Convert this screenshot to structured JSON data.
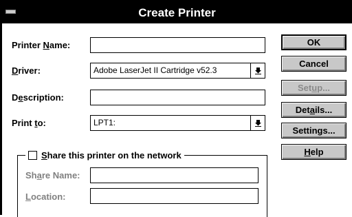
{
  "window": {
    "title": "Create Printer"
  },
  "fields": {
    "printer_name": {
      "label_pre": "Printer ",
      "label_ul": "N",
      "label_post": "ame:",
      "value": ""
    },
    "driver": {
      "label_pre": "",
      "label_ul": "D",
      "label_post": "river:",
      "value": "Adobe LaserJet II Cartridge v52.3"
    },
    "description": {
      "label_pre": "D",
      "label_ul": "e",
      "label_post": "scription:",
      "value": ""
    },
    "print_to": {
      "label_pre": "Print ",
      "label_ul": "t",
      "label_post": "o:",
      "value": "LPT1:"
    }
  },
  "share": {
    "checkbox_pre": "",
    "checkbox_ul": "S",
    "checkbox_post": "hare this printer on the network",
    "checked": false,
    "share_name": {
      "label_pre": "Sh",
      "label_ul": "a",
      "label_post": "re Name:",
      "value": ""
    },
    "location": {
      "label_pre": "",
      "label_ul": "L",
      "label_post": "ocation:",
      "value": ""
    }
  },
  "buttons": {
    "ok": {
      "pre": "",
      "ul": "",
      "post": "OK"
    },
    "cancel": {
      "pre": "",
      "ul": "",
      "post": "Cancel"
    },
    "setup": {
      "pre": "Set",
      "ul": "u",
      "post": "p..."
    },
    "details": {
      "pre": "Det",
      "ul": "a",
      "post": "ils..."
    },
    "settings": {
      "pre": "Settings...",
      "ul": "",
      "post": ""
    },
    "help": {
      "pre": "",
      "ul": "H",
      "post": "elp"
    }
  },
  "icons": {
    "system_menu": "system-menu-icon",
    "dropdown": "down-arrow-icon"
  }
}
